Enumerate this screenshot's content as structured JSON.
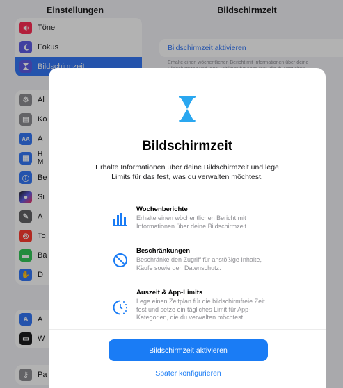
{
  "sidebar": {
    "title": "Einstellungen",
    "items": [
      {
        "label": "Töne",
        "icon": "speaker-icon",
        "color": "#ff2d55"
      },
      {
        "label": "Fokus",
        "icon": "moon-icon",
        "color": "#5e5ce6"
      },
      {
        "label": "Bildschirmzeit",
        "icon": "hourglass-icon",
        "color": "#5e5ce6",
        "selected": true
      },
      {
        "label": "Al",
        "icon": "gear-icon",
        "color": "#8e8e93"
      },
      {
        "label": "Ko",
        "icon": "control-center-icon",
        "color": "#8e8e93"
      },
      {
        "label": "A",
        "icon": "text-size-icon",
        "color": "#3478f6",
        "glyph": "AA"
      },
      {
        "label": "H",
        "label2": "M",
        "icon": "home-screen-icon",
        "color": "#3478f6"
      },
      {
        "label": "Be",
        "icon": "accessibility-icon",
        "color": "#3478f6"
      },
      {
        "label": "Si",
        "icon": "siri-icon",
        "color": "#222222"
      },
      {
        "label": "A",
        "icon": "pencil-icon",
        "color": "#636366"
      },
      {
        "label": "To",
        "icon": "touch-id-icon",
        "color": "#ff3b30"
      },
      {
        "label": "Ba",
        "icon": "battery-icon",
        "color": "#34c759"
      },
      {
        "label": "D",
        "icon": "privacy-hand-icon",
        "color": "#3478f6"
      },
      {
        "label": "A",
        "icon": "app-store-icon",
        "color": "#3478f6"
      },
      {
        "label": "W",
        "icon": "wallet-icon",
        "color": "#1c1c1e"
      },
      {
        "label": "Pa",
        "icon": "passwords-key-icon",
        "color": "#8e8e93"
      }
    ]
  },
  "detail": {
    "title": "Bildschirmzeit",
    "activate_label": "Bildschirmzeit aktivieren",
    "note_line1": "Erhalte einen wöchentlichen Bericht mit Informationen über deine",
    "note_line2": "Bildschirmzeit und lege Zeitlimits für Apps fest, die du verwalten"
  },
  "modal": {
    "title": "Bildschirmzeit",
    "subtitle": "Erhalte Informationen über deine Bildschirmzeit und lege Limits für das fest, was du verwalten möchtest.",
    "features": [
      {
        "title": "Wochenberichte",
        "description": "Erhalte einen wöchentlichen Bericht mit Informationen über deine Bildschirmzeit.",
        "icon": "bar-chart-icon"
      },
      {
        "title": "Beschränkungen",
        "description": "Beschränke den Zugriff für anstößige Inhalte, Käufe sowie den Datenschutz.",
        "icon": "prohibited-icon"
      },
      {
        "title": "Auszeit & App-Limits",
        "description": "Lege einen Zeitplan für die bildschirmfreie Zeit fest und setze ein tägliches Limit für App-Kategorien, die du verwalten möchtest.",
        "icon": "downtime-icon"
      }
    ],
    "primary_button": "Bildschirmzeit aktivieren",
    "secondary_button": "Später konfigurieren"
  },
  "colors": {
    "accent": "#1a7cf5",
    "hourglass": "#2aa7f0"
  }
}
